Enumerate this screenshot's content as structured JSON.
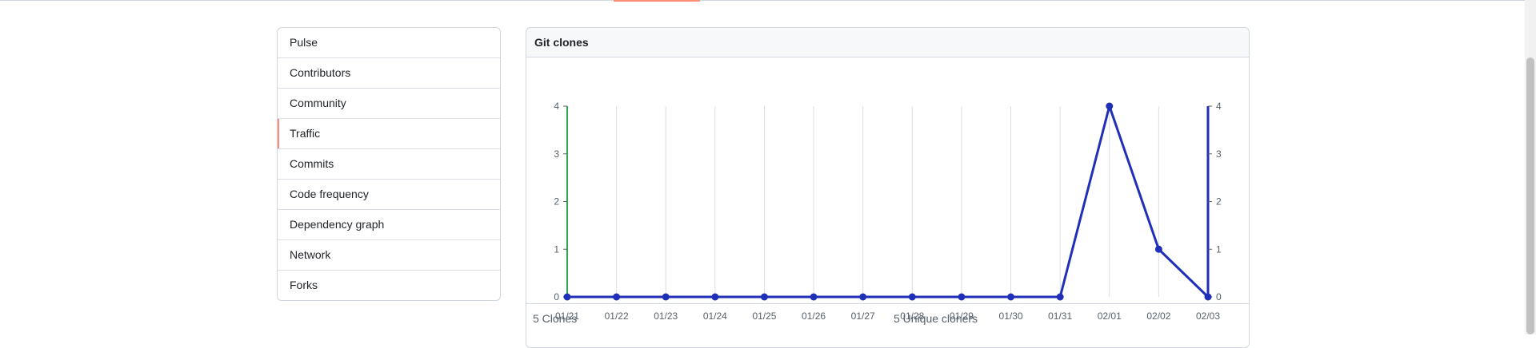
{
  "menu": {
    "items": [
      {
        "label": "Pulse",
        "selected": false
      },
      {
        "label": "Contributors",
        "selected": false
      },
      {
        "label": "Community",
        "selected": false
      },
      {
        "label": "Traffic",
        "selected": true
      },
      {
        "label": "Commits",
        "selected": false
      },
      {
        "label": "Code frequency",
        "selected": false
      },
      {
        "label": "Dependency graph",
        "selected": false
      },
      {
        "label": "Network",
        "selected": false
      },
      {
        "label": "Forks",
        "selected": false
      }
    ]
  },
  "git_clones": {
    "title": "Git clones",
    "clones_label": "5 Clones",
    "uniques_label": "5 Unique cloners"
  },
  "colors": {
    "accent": "#fd8c73",
    "series_line": "#1f2fb7",
    "green_axis": "#2da44e"
  },
  "chart_data": {
    "type": "line",
    "title": "Git clones",
    "x": [
      "01/21",
      "01/22",
      "01/23",
      "01/24",
      "01/25",
      "01/26",
      "01/27",
      "01/28",
      "01/29",
      "01/30",
      "01/31",
      "02/01",
      "02/02",
      "02/03"
    ],
    "series": [
      {
        "name": "Clones",
        "values": [
          0,
          0,
          0,
          0,
          0,
          0,
          0,
          0,
          0,
          0,
          0,
          4,
          1,
          0
        ]
      }
    ],
    "ylim": [
      0,
      4
    ],
    "yticks": [
      0,
      1,
      2,
      3,
      4
    ],
    "grid": true
  }
}
